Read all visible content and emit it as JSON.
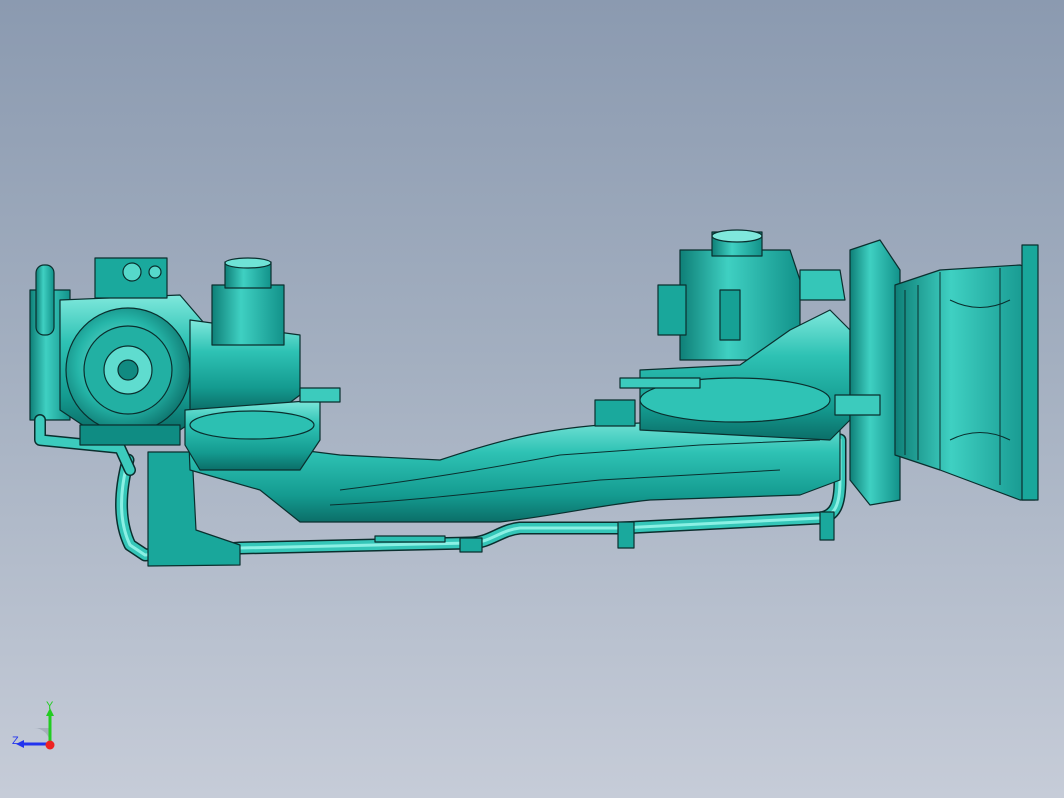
{
  "viewport": {
    "background_top": "#8b9ab0",
    "background_bottom": "#c6ccd8",
    "model_fill": "#1fb3a6",
    "model_highlight": "#6fe3d6",
    "model_shadow": "#0b6e68",
    "model_edge": "#0a2f2e"
  },
  "triad": {
    "y_label": "Y",
    "z_label": "Z",
    "y_color": "#22cc22",
    "z_color": "#2233ee",
    "x_color": "#ee2222"
  }
}
